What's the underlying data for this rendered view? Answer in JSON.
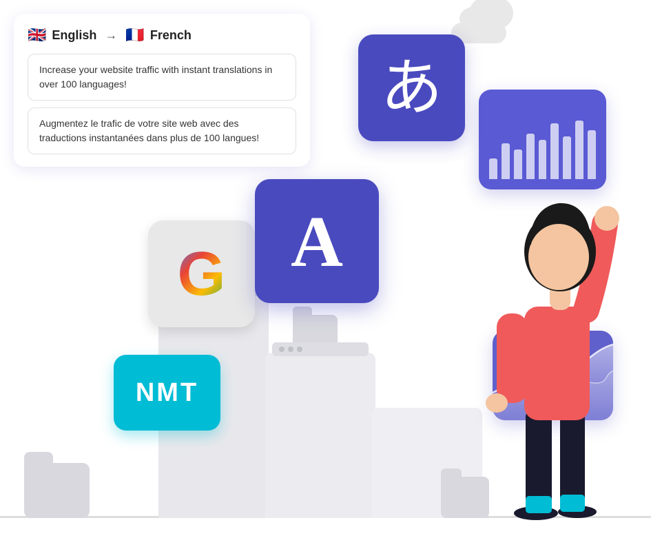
{
  "translation_card": {
    "source_lang": "English",
    "source_flag": "🇬🇧",
    "target_lang": "French",
    "target_flag": "🇫🇷",
    "arrow": "→",
    "source_text": "Increase your website traffic with instant translations in over 100 languages!",
    "translated_text": "Augmentez le trafic de votre site web avec des traductions instantanées dans plus de 100 langues!"
  },
  "icons": {
    "japanese_char": "あ",
    "translate_letter": "A",
    "google_letter": "G",
    "nmt_label": "NMT"
  },
  "bars": [
    30,
    55,
    45,
    70,
    60,
    85,
    65,
    90,
    75
  ],
  "colors": {
    "purple_dark": "#4a4abf",
    "purple_mid": "#5a5ad4",
    "purple_light": "#6060cc",
    "teal": "#00bcd4",
    "cloud": "#e8e8e8",
    "step": "#e5e5ea",
    "folder": "#d8d8de"
  }
}
